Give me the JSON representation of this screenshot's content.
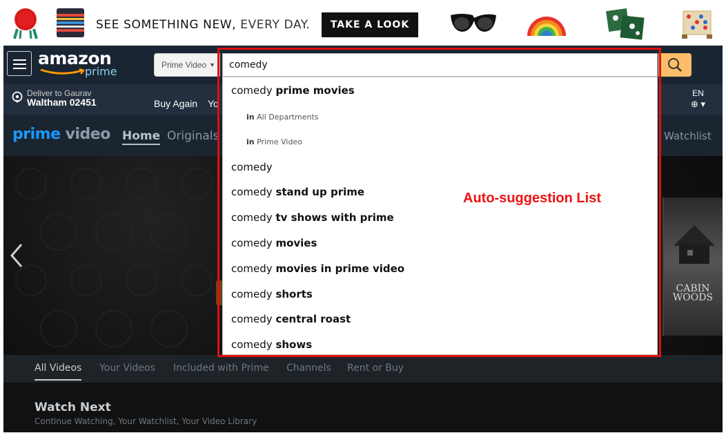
{
  "promo": {
    "text_main": "SEE SOMETHING NEW,",
    "text_light": "EVERY DAY.",
    "button_label": "TAKE A LOOK",
    "images": [
      "red-chair-image",
      "striped-blanket-image",
      "sunglasses-image",
      "rainbow-image",
      "leaf-pillow-image",
      "connect-four-game-image"
    ]
  },
  "nav": {
    "logo_text": "amazon",
    "logo_sub": "prime",
    "search_department": "Prime Video",
    "search_query": "comedy",
    "deliver_to": "Deliver to Gaurav",
    "deliver_location": "Waltham 02451",
    "links": [
      "Buy Again",
      "Yo"
    ],
    "language": "EN"
  },
  "prime_video": {
    "logo_prime": "prime",
    "logo_video": "video",
    "nav_items": [
      "Home",
      "Originals"
    ],
    "watchlist": "Watchlist"
  },
  "hero": {
    "poster_title": "CABIN WOODS"
  },
  "suggestions": [
    {
      "prefix": "comedy",
      "bold": "prime movies"
    },
    {
      "prefix": "comedy",
      "bold": ""
    },
    {
      "prefix": "comedy",
      "bold": "stand up prime"
    },
    {
      "prefix": "comedy",
      "bold": "tv shows with prime"
    },
    {
      "prefix": "comedy",
      "bold": "movies"
    },
    {
      "prefix": "comedy",
      "bold": "movies in prime video"
    },
    {
      "prefix": "comedy",
      "bold": "shorts"
    },
    {
      "prefix": "comedy",
      "bold": "central roast"
    },
    {
      "prefix": "comedy",
      "bold": "shows"
    }
  ],
  "department_scopes": [
    {
      "in": "in",
      "label": "All Departments"
    },
    {
      "in": "in",
      "label": "Prime Video"
    }
  ],
  "tabs": [
    "All Videos",
    "Your Videos",
    "Included with Prime",
    "Channels",
    "Rent or Buy"
  ],
  "watch_next": {
    "title": "Watch Next",
    "subtitle": "Continue Watching, Your Watchlist, Your Video Library"
  },
  "annotation": {
    "label": "Auto-suggestion List",
    "color": "#ee1111"
  }
}
